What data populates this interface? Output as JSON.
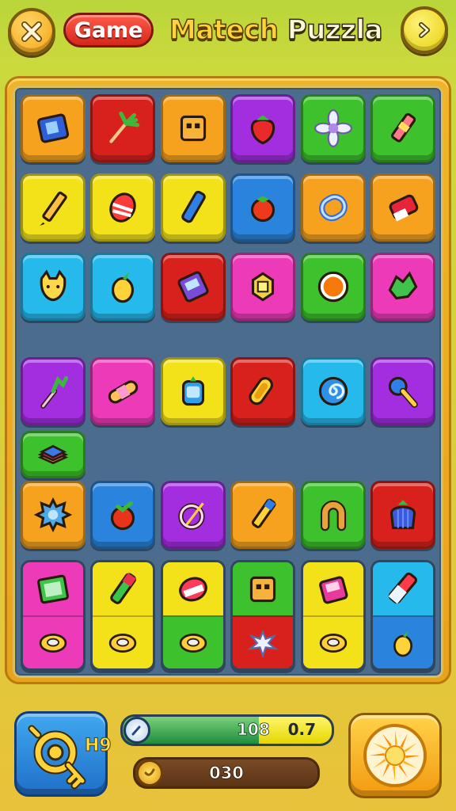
{
  "header": {
    "close_icon": "close-x-icon",
    "mode_label": "Game",
    "title_part1": "Matech",
    "title_part2": "Puzzla",
    "next_icon": "arrow-right-icon"
  },
  "colors": {
    "orange": "#f6a21e",
    "red": "#d8211c",
    "purple": "#a22ee0",
    "green": "#3dc12c",
    "yellow": "#f3e21a",
    "cyan": "#25b9ec",
    "blue": "#2a83dc",
    "pink": "#ec3ab8",
    "board": "#4c6c8e",
    "frame": "#e8a31c"
  },
  "rows": [
    {
      "tiles": [
        {
          "color": "orange",
          "icon": "blue-book-icon"
        },
        {
          "color": "red",
          "icon": "palm-wand-icon"
        },
        {
          "color": "orange",
          "icon": "cube-box-icon"
        },
        {
          "color": "purple",
          "icon": "strawberry-icon"
        },
        {
          "color": "green",
          "icon": "flower-icon"
        },
        {
          "color": "green",
          "icon": "crayon-icon"
        }
      ]
    },
    {
      "tiles": [
        {
          "color": "yellow",
          "icon": "pencil-icon"
        },
        {
          "color": "yellow",
          "icon": "striped-barrel-icon"
        },
        {
          "color": "yellow",
          "icon": "blue-crayon-icon"
        },
        {
          "color": "blue",
          "icon": "tomato-icon"
        },
        {
          "color": "orange",
          "icon": "paperclip-icon"
        },
        {
          "color": "orange",
          "icon": "red-eraser-icon"
        }
      ]
    },
    {
      "tiles": [
        {
          "color": "cyan",
          "icon": "cat-face-icon"
        },
        {
          "color": "cyan",
          "icon": "lemon-icon"
        },
        {
          "color": "red",
          "icon": "phone-icon"
        },
        {
          "color": "pink",
          "icon": "gem-block-icon"
        },
        {
          "color": "green",
          "icon": "orange-coin-icon"
        },
        {
          "color": "pink",
          "icon": "leaf-icon"
        }
      ]
    },
    {
      "tiles": [
        {
          "color": "purple",
          "icon": "radish-icon"
        },
        {
          "color": "pink",
          "icon": "bandage-icon"
        },
        {
          "color": "yellow",
          "icon": "jar-icon"
        },
        {
          "color": "red",
          "icon": "safety-pin-icon"
        },
        {
          "color": "cyan",
          "icon": "swirl-icon"
        },
        {
          "color": "purple",
          "icon": "rattle-icon"
        }
      ]
    },
    {
      "tiles": [
        {
          "color": "orange",
          "icon": "gear-splat-icon"
        },
        {
          "color": "blue",
          "icon": "cherry-icon"
        },
        {
          "color": "purple",
          "icon": "ring-needle-icon"
        },
        {
          "color": "orange",
          "icon": "blue-pencil-icon"
        },
        {
          "color": "green",
          "icon": "horseshoe-icon"
        },
        {
          "color": "red",
          "icon": "striped-bag-icon"
        }
      ]
    }
  ],
  "extra_tile": {
    "color": "green",
    "icon": "layered-cake-icon"
  },
  "split_row": [
    {
      "top": "pink",
      "bottom": "pink",
      "icon_top": "picture-frame-icon",
      "icon_bottom": "ring-donut-icon"
    },
    {
      "top": "yellow",
      "bottom": "yellow",
      "icon_top": "paint-tube-icon",
      "icon_bottom": "ring-donut-icon"
    },
    {
      "top": "yellow",
      "bottom": "green",
      "icon_top": "drum-can-icon",
      "icon_bottom": "ring-donut-icon"
    },
    {
      "top": "green",
      "bottom": "red",
      "icon_top": "cube-box-icon",
      "icon_bottom": "splat-icon"
    },
    {
      "top": "yellow",
      "bottom": "yellow",
      "icon_top": "pink-box-icon",
      "icon_bottom": "ring-donut-icon"
    },
    {
      "top": "cyan",
      "bottom": "blue",
      "icon_top": "battery-icon",
      "icon_bottom": "lemon-icon"
    }
  ],
  "footer": {
    "power_icon": "key-gear-icon",
    "power_count": "H9",
    "progress_value": "108",
    "progress_side": "0.7",
    "progress_fraction": 0.65,
    "progress_icon": "clock-icon",
    "coin_icon": "coin-icon",
    "coins": "030",
    "bomb_icon": "sunburst-icon"
  }
}
